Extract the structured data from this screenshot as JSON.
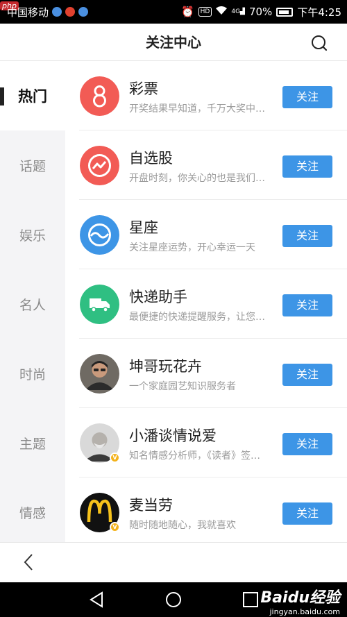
{
  "status_bar": {
    "php_badge": "php",
    "carrier": "中国移动",
    "battery": "70%",
    "time": "下午4:25",
    "hd": "HD",
    "signal": "4G"
  },
  "header": {
    "title": "关注中心"
  },
  "sidebar": {
    "items": [
      {
        "label": "热门",
        "active": true
      },
      {
        "label": "话题",
        "active": false
      },
      {
        "label": "娱乐",
        "active": false
      },
      {
        "label": "名人",
        "active": false
      },
      {
        "label": "时尚",
        "active": false
      },
      {
        "label": "主题",
        "active": false
      },
      {
        "label": "情感",
        "active": false
      }
    ]
  },
  "list": {
    "items": [
      {
        "name": "彩票",
        "desc": "开奖结果早知道，千万大奖中…",
        "button": "关注",
        "icon": "lottery-icon",
        "color": "#f25b55"
      },
      {
        "name": "自选股",
        "desc": "开盘时刻，你关心的也是我们…",
        "button": "关注",
        "icon": "stock-chart-icon",
        "color": "#f25b55"
      },
      {
        "name": "星座",
        "desc": "关注星座运势，开心幸运一天",
        "button": "关注",
        "icon": "horoscope-icon",
        "color": "#3d95e6"
      },
      {
        "name": "快递助手",
        "desc": "最便捷的快递提醒服务，让您…",
        "button": "关注",
        "icon": "delivery-truck-icon",
        "color": "#2fbf82"
      },
      {
        "name": "坤哥玩花卉",
        "desc": "一个家庭园艺知识服务者",
        "button": "关注",
        "icon": "user-avatar-photo",
        "color": "#3a3a3a"
      },
      {
        "name": "小潘谈情说爱",
        "desc": "知名情感分析师，《读者》签…",
        "button": "关注",
        "icon": "user-avatar-portrait",
        "color": "#9a9a9a",
        "verified": true
      },
      {
        "name": "麦当劳",
        "desc": "随时随地随心，我就喜欢",
        "button": "关注",
        "icon": "mcdonalds-logo",
        "color": "#111111",
        "verified": true
      }
    ]
  },
  "watermark": {
    "main": "Baidu经验",
    "sub": "jingyan.baidu.com"
  }
}
